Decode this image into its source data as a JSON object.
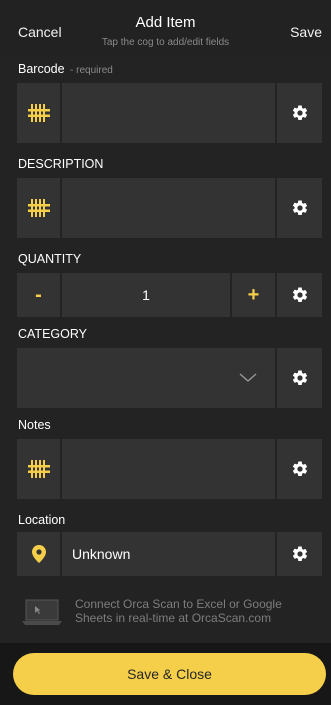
{
  "header": {
    "cancel_label": "Cancel",
    "title": "Add Item",
    "subtitle": "Tap the cog to add/edit fields",
    "save_label": "Save"
  },
  "fields": {
    "barcode": {
      "label": "Barcode",
      "hint": "- required",
      "left_icon": "barcode-icon"
    },
    "description": {
      "label": "DESCRIPTION",
      "left_icon": "barcode-icon"
    },
    "quantity": {
      "label": "QUANTITY",
      "value": "1",
      "minus": "-",
      "plus": "+"
    },
    "category": {
      "label": "CATEGORY",
      "right_icon": "chevron-down-icon"
    },
    "notes": {
      "label": "Notes",
      "left_icon": "barcode-icon"
    },
    "location": {
      "label": "Location",
      "value": "Unknown",
      "left_icon": "location-pin-icon"
    }
  },
  "info_text": "Connect Orca Scan to Excel or Google Sheets in real-time at OrcaScan.com",
  "save_close_label": "Save & Close",
  "colors": {
    "accent": "#f5cf4a",
    "background": "#232323",
    "field": "#333333",
    "text_muted": "#8a8a8a"
  }
}
